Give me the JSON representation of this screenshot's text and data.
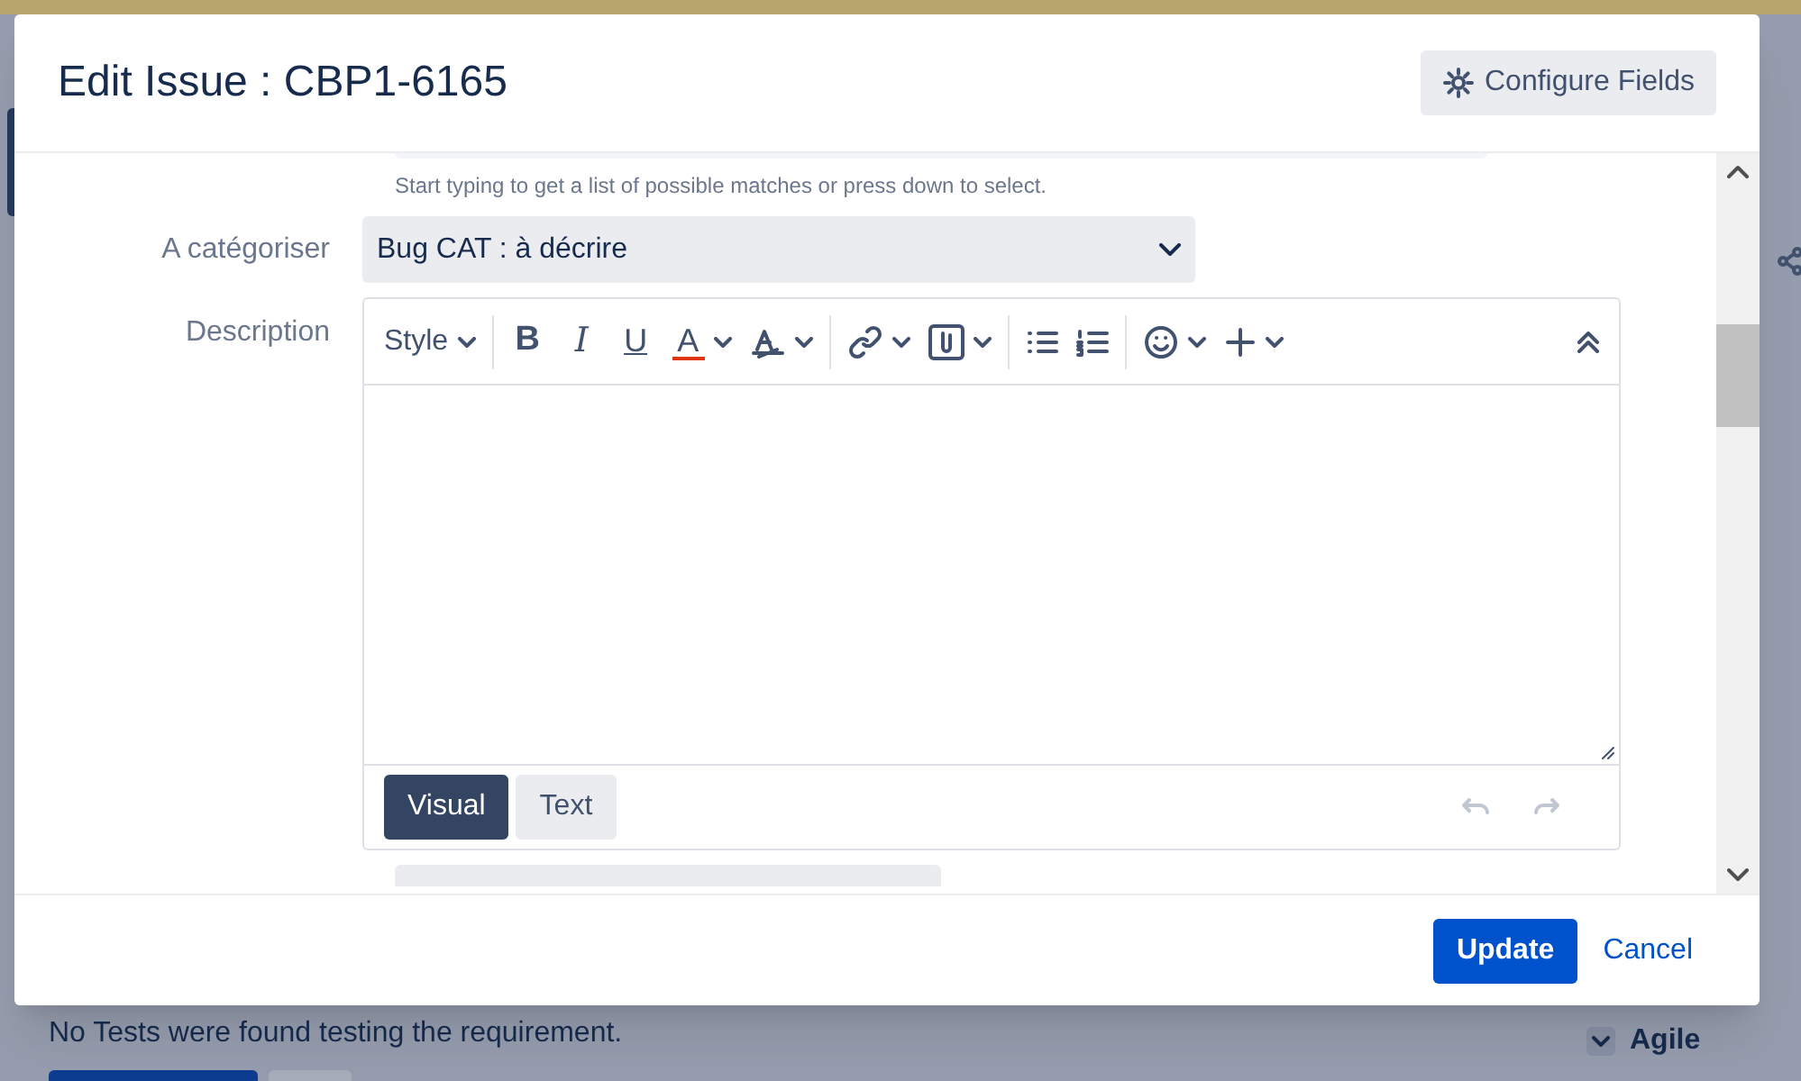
{
  "background": {
    "message": "No Tests were found testing the requirement.",
    "section": {
      "label": "Agile",
      "expanded": false
    }
  },
  "dialog": {
    "title": "Edit Issue : CBP1-6165",
    "configure_button": "Configure Fields",
    "fields": [
      {
        "kind": "hint",
        "text": "Start typing to get a list of possible matches or press down to select."
      },
      {
        "kind": "select",
        "label": "A catégoriser",
        "value": "Bug CAT : à décrire"
      },
      {
        "kind": "editor",
        "label": "Description",
        "style_label": "Style",
        "bold": "B",
        "italic": "I",
        "underline": "U",
        "font_color_letter": "A",
        "modes": [
          {
            "label": "Visual",
            "selected": true
          },
          {
            "label": "Text",
            "selected": false
          }
        ]
      }
    ],
    "update_button": "Update",
    "cancel_link": "Cancel"
  }
}
